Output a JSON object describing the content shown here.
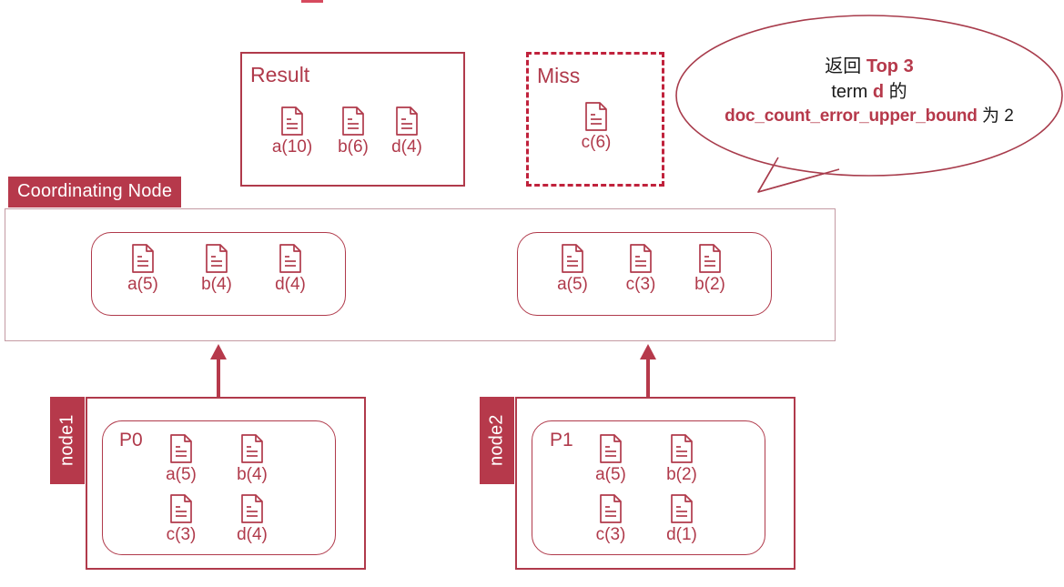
{
  "colors": {
    "accent": "#b03a4b",
    "tag_bg": "#b6394b",
    "dashed": "#c0223c",
    "text_dark": "#1a1a1a"
  },
  "result_box": {
    "title": "Result",
    "docs": [
      {
        "label": "a(10)"
      },
      {
        "label": "b(6)"
      },
      {
        "label": "d(4)"
      }
    ]
  },
  "miss_box": {
    "title": "Miss",
    "docs": [
      {
        "label": "c(6)"
      }
    ]
  },
  "callout": {
    "line1_prefix": "返回 ",
    "line1_highlight": "Top 3",
    "line2_prefix": "term ",
    "line2_highlight": "d",
    "line2_suffix": " 的",
    "line3_highlight": "doc_count_error_upper_bound",
    "line3_suffix": " 为 2"
  },
  "coordinating_node": {
    "tag": "Coordinating Node",
    "groups": [
      {
        "docs": [
          {
            "label": "a(5)"
          },
          {
            "label": "b(4)"
          },
          {
            "label": "d(4)"
          }
        ]
      },
      {
        "docs": [
          {
            "label": "a(5)"
          },
          {
            "label": "c(3)"
          },
          {
            "label": "b(2)"
          }
        ]
      }
    ]
  },
  "nodes": [
    {
      "tag": "node1",
      "shard": "P0",
      "docs": [
        {
          "label": "a(5)"
        },
        {
          "label": "b(4)"
        },
        {
          "label": "c(3)"
        },
        {
          "label": "d(4)"
        }
      ]
    },
    {
      "tag": "node2",
      "shard": "P1",
      "docs": [
        {
          "label": "a(5)"
        },
        {
          "label": "b(2)"
        },
        {
          "label": "c(3)"
        },
        {
          "label": "d(1)"
        }
      ]
    }
  ],
  "icons": {
    "document": "document-icon",
    "arrow_up": "arrow-up-icon"
  }
}
